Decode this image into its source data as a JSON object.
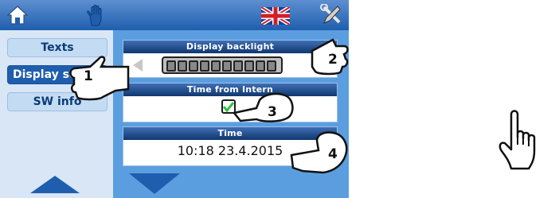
{
  "sidebar": {
    "items": [
      {
        "label": "Texts"
      },
      {
        "label": "Display set"
      },
      {
        "label": "SW info"
      }
    ]
  },
  "panels": {
    "backlight": {
      "title": "Display backlight",
      "segments": 10
    },
    "internet": {
      "title": "Time from Intern",
      "checked": true
    },
    "time": {
      "title": "Time",
      "value": "10:18  23.4.2015"
    }
  },
  "callouts": [
    "1",
    "2",
    "3",
    "4"
  ],
  "icons": [
    "home-icon",
    "manual-mode-hand-icon",
    "uk-flag-icon",
    "tools-icon",
    "scroll-up-arrow-icon",
    "scroll-down-arrow-icon",
    "pointing-hand-cursor-icon"
  ],
  "colors": {
    "topbar": "#1f5eae",
    "sidebar": "#d8e6f5",
    "content": "#5b9ee0",
    "active": "#1f5eae",
    "check": "#2fbf3a"
  }
}
